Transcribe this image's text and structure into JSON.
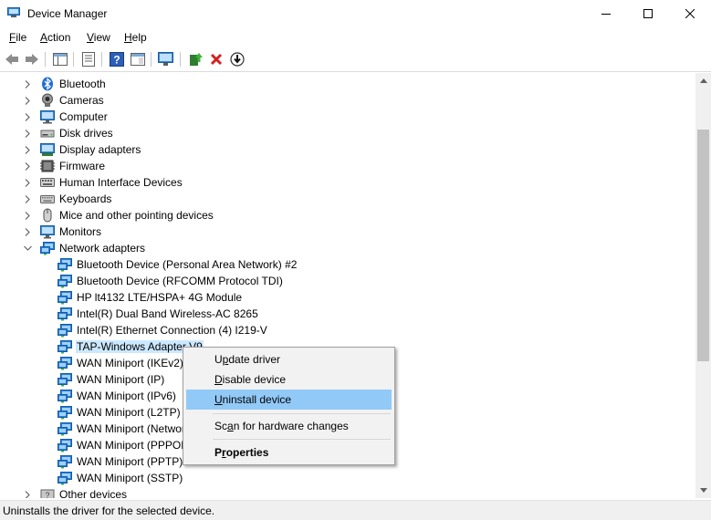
{
  "window": {
    "title": "Device Manager"
  },
  "menu": [
    {
      "label": "File",
      "hotkey": "F",
      "rest": "ile"
    },
    {
      "label": "Action",
      "hotkey": "A",
      "rest": "ction"
    },
    {
      "label": "View",
      "hotkey": "V",
      "rest": "iew"
    },
    {
      "label": "Help",
      "hotkey": "H",
      "rest": "elp"
    }
  ],
  "tree": {
    "categories": [
      {
        "label": "Bluetooth",
        "icon": "bluetooth-icon"
      },
      {
        "label": "Cameras",
        "icon": "camera-icon"
      },
      {
        "label": "Computer",
        "icon": "computer-icon"
      },
      {
        "label": "Disk drives",
        "icon": "disk-drive-icon"
      },
      {
        "label": "Display adapters",
        "icon": "display-adapter-icon"
      },
      {
        "label": "Firmware",
        "icon": "firmware-icon"
      },
      {
        "label": "Human Interface Devices",
        "icon": "hid-icon"
      },
      {
        "label": "Keyboards",
        "icon": "keyboard-icon"
      },
      {
        "label": "Mice and other pointing devices",
        "icon": "mouse-icon"
      },
      {
        "label": "Monitors",
        "icon": "monitor-icon"
      },
      {
        "label": "Network adapters",
        "icon": "network-adapter-icon",
        "expanded": true
      }
    ],
    "network_devices": [
      {
        "label": "Bluetooth Device (Personal Area Network) #2"
      },
      {
        "label": "Bluetooth Device (RFCOMM Protocol TDI)"
      },
      {
        "label": "HP lt4132 LTE/HSPA+ 4G Module"
      },
      {
        "label": "Intel(R) Dual Band Wireless-AC 8265"
      },
      {
        "label": "Intel(R) Ethernet Connection (4) I219-V"
      },
      {
        "label": "TAP-Windows Adapter V9",
        "selected": true
      },
      {
        "label": "WAN Miniport (IKEv2)"
      },
      {
        "label": "WAN Miniport (IP)"
      },
      {
        "label": "WAN Miniport (IPv6)"
      },
      {
        "label": "WAN Miniport (L2TP)"
      },
      {
        "label": "WAN Miniport (Network Monitor)"
      },
      {
        "label": "WAN Miniport (PPPOE)"
      },
      {
        "label": "WAN Miniport (PPTP)"
      },
      {
        "label": "WAN Miniport (SSTP)"
      }
    ],
    "after": [
      {
        "label": "Other devices",
        "icon": "other-devices-icon"
      }
    ]
  },
  "context_menu": {
    "items": [
      {
        "label": "Update driver",
        "hotkey": "p",
        "pre": "U",
        "post": "date driver"
      },
      {
        "label": "Disable device",
        "hotkey": "D",
        "pre": "",
        "post": "isable device"
      },
      {
        "label": "Uninstall device",
        "hotkey": "U",
        "pre": "",
        "post": "ninstall device",
        "highlighted": true
      },
      {
        "label": "Scan for hardware changes",
        "hotkey": "a",
        "pre": "Sc",
        "post": "n for hardware changes"
      },
      {
        "label": "Properties",
        "hotkey": "r",
        "pre": "P",
        "post": "operties",
        "bold": true
      }
    ]
  },
  "status": {
    "text": "Uninstalls the driver for the selected device."
  },
  "colors": {
    "selection": "#cce8ff",
    "menu_highlight": "#91c9f7",
    "network_icon": "#2a7fd4"
  }
}
